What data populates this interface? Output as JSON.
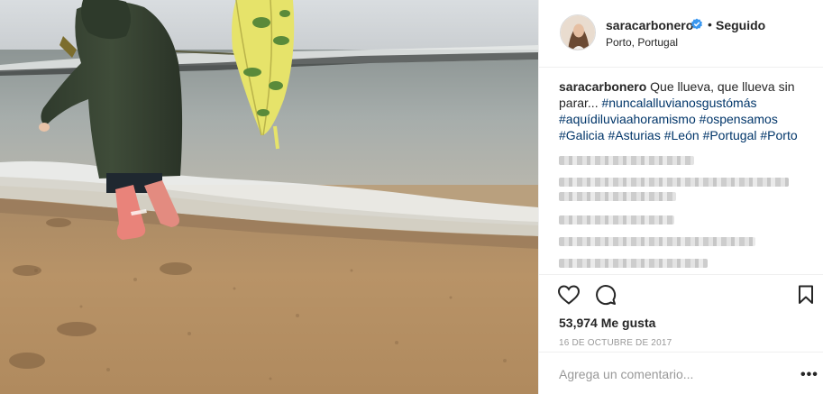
{
  "post": {
    "username": "saracarbonero",
    "follow_status": "Seguido",
    "separator": "•",
    "location": "Porto, Portugal",
    "verified": true
  },
  "caption": {
    "username": "saracarbonero",
    "text": "Que llueva, que llueva sin parar...",
    "hashtags": [
      "#nuncalalluvianosgustómás",
      "#aquídiluviaahoramismo",
      "#ospensamos",
      "#Galicia",
      "#Asturias",
      "#León",
      "#Portugal",
      "#Porto"
    ]
  },
  "stats": {
    "likes": "53,974 Me gusta",
    "date": "16 DE OCTUBRE DE 2017"
  },
  "comment_box": {
    "placeholder": "Agrega un comentario...",
    "more": "•••"
  },
  "icons": {
    "like": "heart-icon",
    "comment": "comment-bubble-icon",
    "save": "bookmark-icon",
    "verified": "verified-badge-icon"
  },
  "colors": {
    "hashtag": "#003569",
    "verified": "#3897f0",
    "muted": "#999999",
    "border": "#efefef"
  }
}
